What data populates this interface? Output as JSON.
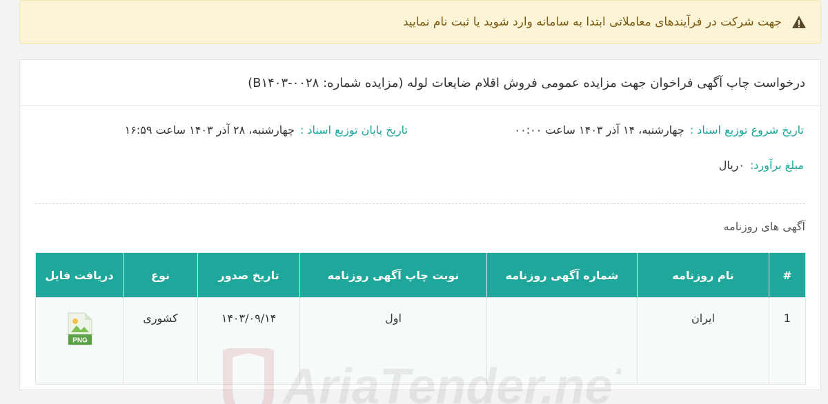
{
  "alert": {
    "text": "جهت شرکت در فرآیندهای معاملاتی ابتدا به سامانه وارد شوید یا ثبت نام نمایید",
    "icon": "warning-icon",
    "color": "#7a5a14"
  },
  "card": {
    "title": "درخواست چاپ آگهی فراخوان جهت مزایده عمومی فروش اقلام ضایعات لوله (مزایده شماره: ۰۰۲۸-B۱۴۰۳)",
    "start_label": "تاریخ شروع توزیع اسناد :",
    "start_value": "چهارشنبه، ۱۴ آذر ۱۴۰۳ ساعت ۰۰:۰۰",
    "end_label": "تاریخ پایان توزیع اسناد :",
    "end_value": "چهارشنبه، ۲۸ آذر ۱۴۰۳ ساعت ۱۶:۵۹",
    "amount_label": "مبلغ برآورد:",
    "amount_value": "۰ریال",
    "section_title": "آگهی های روزنامه"
  },
  "table": {
    "headers": [
      "#",
      "نام روزنامه",
      "شماره آگهی روزنامه",
      "نوبت چاپ آگهی روزنامه",
      "تاریخ صدور",
      "نوع",
      "دریافت فایل"
    ],
    "rows": [
      {
        "num": "1",
        "paper": "ایران",
        "ad_number": "",
        "turn": "اول",
        "date": "۱۴۰۳/۰۹/۱۴",
        "type": "کشوری",
        "file_label": "PNG",
        "file_icon": "png-file-icon"
      }
    ]
  },
  "watermark": {
    "text": "AriaTender.neT"
  },
  "colors": {
    "accent": "#1ea79a",
    "alert_bg": "#fcf4d6"
  }
}
